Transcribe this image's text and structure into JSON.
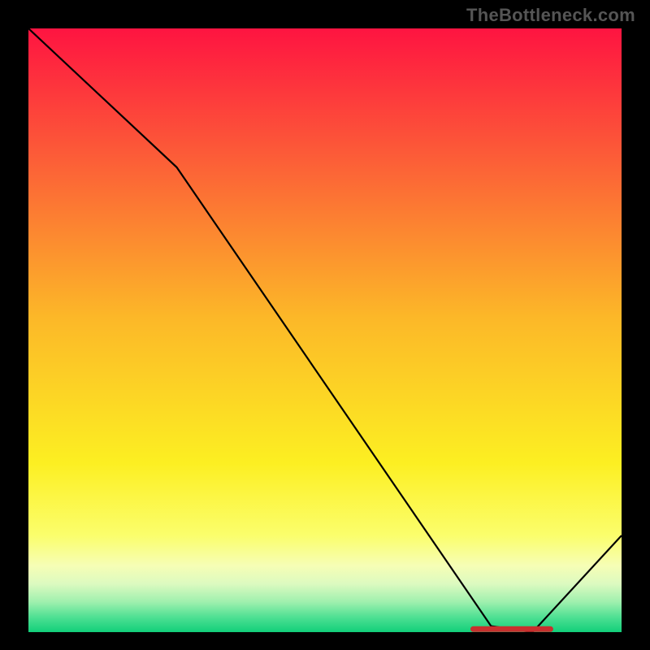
{
  "watermark": "TheBottleneck.com",
  "marker_label": "",
  "chart_data": {
    "type": "line",
    "title": "",
    "xlabel": "",
    "ylabel": "",
    "xlim": [
      0,
      100
    ],
    "ylim": [
      0,
      100
    ],
    "background_gradient_stops": [
      {
        "pct": 0,
        "color": "#fe1441"
      },
      {
        "pct": 22,
        "color": "#fc5f37"
      },
      {
        "pct": 48,
        "color": "#fcb828"
      },
      {
        "pct": 72,
        "color": "#fcef22"
      },
      {
        "pct": 84,
        "color": "#fbfe6c"
      },
      {
        "pct": 89,
        "color": "#f6feb5"
      },
      {
        "pct": 92,
        "color": "#dcfac0"
      },
      {
        "pct": 95,
        "color": "#9ff0ae"
      },
      {
        "pct": 97.5,
        "color": "#4fe093"
      },
      {
        "pct": 100,
        "color": "#12cf7a"
      }
    ],
    "series": [
      {
        "name": "bottleneck-curve",
        "x": [
          0,
          25,
          78,
          85,
          100
        ],
        "values": [
          100,
          77,
          1,
          0,
          16
        ],
        "color": "#000000"
      }
    ],
    "annotations": [
      {
        "type": "segment",
        "name": "red-baseline-marker",
        "x0": 75,
        "x1": 88,
        "y": 0.5,
        "color": "#c8302e",
        "label": ""
      }
    ]
  }
}
